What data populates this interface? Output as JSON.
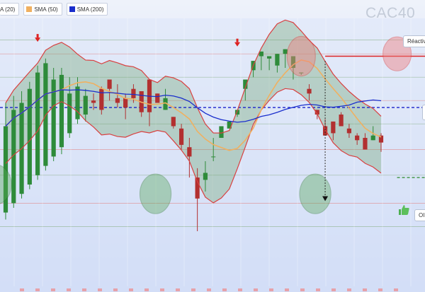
{
  "legend": [
    {
      "label": "A (20)",
      "color": "#3a8a3a"
    },
    {
      "label": "SMA (50)",
      "color": "#f0b060"
    },
    {
      "label": "SMA (200)",
      "color": "#1a2ecc"
    }
  ],
  "watermark": "CAC40",
  "buttons": {
    "reactivate_label": "Réactiv",
    "ok_label": "OI"
  },
  "icons": {
    "thumb": "thumbs-up-icon"
  },
  "chart_data": {
    "type": "candlestick",
    "indicators": [
      "Bollinger (20)",
      "SMA (50)",
      "SMA (200)"
    ],
    "ylim": [
      0,
      100
    ],
    "resistance": {
      "from": 40,
      "to": 74,
      "y": 85
    },
    "support_mid": {
      "y": 63
    },
    "support_low_dashed": {
      "from": 49,
      "to": 81,
      "y": 33
    },
    "candles": [
      [
        18,
        55,
        65,
        15,
        -1
      ],
      [
        22,
        62,
        68,
        20,
        1
      ],
      [
        26,
        65,
        70,
        24,
        1
      ],
      [
        30,
        71,
        74,
        28,
        1
      ],
      [
        34,
        78,
        81,
        32,
        1
      ],
      [
        38,
        82,
        84,
        36,
        1
      ],
      [
        42,
        75,
        80,
        40,
        -1
      ],
      [
        46,
        77,
        80,
        43,
        1
      ],
      [
        52,
        69,
        76,
        50,
        -1
      ],
      [
        58,
        72,
        76,
        56,
        1
      ],
      [
        60,
        68,
        71,
        57,
        -1
      ],
      [
        66,
        65,
        69,
        62,
        1
      ],
      [
        71,
        62,
        72,
        60,
        1
      ],
      [
        75,
        71,
        74,
        66,
        -1
      ],
      [
        67,
        65,
        73,
        63,
        -1
      ],
      [
        67,
        63,
        69,
        58,
        -1
      ],
      [
        71,
        67,
        73,
        65,
        1
      ],
      [
        70,
        61,
        69,
        59,
        -1
      ],
      [
        75,
        61,
        66,
        55,
        1
      ],
      [
        69,
        65,
        67,
        67,
        -1
      ],
      [
        62,
        67,
        71,
        62,
        1
      ],
      [
        59,
        55,
        58,
        54,
        -1
      ],
      [
        54,
        47,
        56,
        45,
        -1
      ],
      [
        46,
        42,
        50,
        33,
        -1
      ],
      [
        33,
        24,
        37,
        10,
        -1
      ],
      [
        32,
        35,
        40,
        27,
        1
      ],
      [
        42,
        42,
        50,
        40,
        1
      ],
      [
        50,
        55,
        51,
        52,
        1
      ],
      [
        54,
        57,
        55,
        57,
        -1
      ],
      [
        60,
        62,
        58,
        59,
        1
      ],
      [
        71,
        75,
        62,
        66,
        1
      ],
      [
        79,
        83,
        68,
        76,
        1
      ],
      [
        85,
        87,
        74,
        79,
        1
      ],
      [
        84,
        85,
        76,
        79,
        -1
      ],
      [
        81,
        86,
        75,
        78,
        1
      ],
      [
        86,
        88,
        79,
        80,
        1
      ],
      [
        80,
        85,
        78,
        75,
        -1
      ],
      [
        78,
        78,
        76,
        77,
        1
      ],
      [
        71,
        69,
        73,
        66,
        -1
      ],
      [
        62,
        60,
        59,
        58,
        -1
      ],
      [
        55,
        51,
        58,
        51,
        -1
      ],
      [
        57,
        52,
        57,
        49,
        1
      ],
      [
        60,
        55,
        61,
        55,
        1
      ],
      [
        54,
        52,
        56,
        50,
        -1
      ],
      [
        51,
        49,
        52,
        47,
        -1
      ],
      [
        50,
        45,
        52,
        45,
        -1
      ],
      [
        49,
        51,
        55,
        49,
        1
      ],
      [
        51,
        48,
        52,
        44,
        -1
      ]
    ]
  }
}
